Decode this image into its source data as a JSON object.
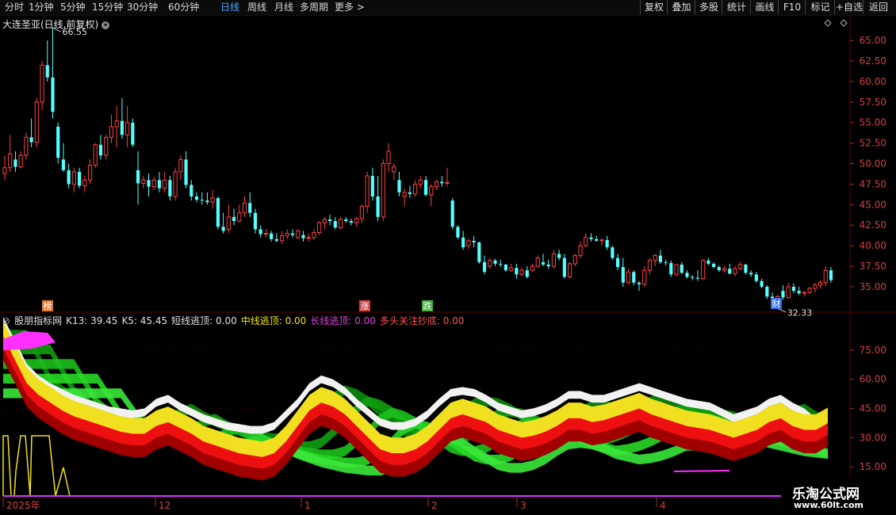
{
  "toolbar": {
    "periods": [
      {
        "label": "分时",
        "active": false
      },
      {
        "label": "1分钟",
        "active": false
      },
      {
        "label": "5分钟",
        "active": false
      },
      {
        "label": "15分钟",
        "active": false
      },
      {
        "label": "30分钟",
        "active": false
      },
      {
        "label": "60分钟",
        "active": false
      },
      {
        "label": "日线",
        "active": true
      },
      {
        "label": "周线",
        "active": false
      },
      {
        "label": "月线",
        "active": false
      },
      {
        "label": "多周期",
        "active": false
      },
      {
        "label": "更多 >",
        "active": false
      }
    ],
    "buttons": [
      "复权",
      "叠加",
      "多股",
      "统计",
      "画线",
      "F10",
      "标记",
      "+自选",
      "返回"
    ]
  },
  "main_chart": {
    "title": "大连圣亚(日线,前复权)",
    "title_icon": "chevron-down-icon",
    "high_label": "66.55",
    "low_label": "32.33",
    "markers": [
      {
        "text": "榜",
        "color": "#e07b2a"
      },
      {
        "text": "涨",
        "color": "#d04040"
      },
      {
        "text": "跌",
        "color": "#3fb040"
      },
      {
        "text": "财",
        "color": "#3a6fe0"
      }
    ]
  },
  "indicator": {
    "name": "股朋指标网",
    "values": [
      {
        "label": "K13: 39.45",
        "color": "#e0e0e0"
      },
      {
        "label": "K5: 45.45",
        "color": "#e0e0e0"
      },
      {
        "label": "短线逃顶: 0.00",
        "color": "#e0e0e0"
      },
      {
        "label": "中线逃顶: 0.00",
        "color": "#f0e020"
      },
      {
        "label": "长线逃顶: 0.00",
        "color": "#e040e0"
      },
      {
        "label": "多头关注抄底: 0.00",
        "color": "#ff5050"
      }
    ]
  },
  "logo": {
    "line1": "乐淘公式网",
    "line2": "www.60lt.com"
  },
  "colors": {
    "up": "#ff4040",
    "down": "#54ffff",
    "grid": "#5a0000"
  },
  "chart_data": [
    {
      "type": "candlestick",
      "title": "大连圣亚(日线,前复权)",
      "y_ticks": [
        "65.00",
        "62.50",
        "60.00",
        "57.50",
        "55.00",
        "52.50",
        "50.00",
        "47.50",
        "45.00",
        "42.50",
        "40.00",
        "37.50",
        "35.00"
      ],
      "ylim": [
        32.0,
        68.0
      ],
      "x_ticks": [
        "2025年",
        "12",
        "1",
        "2",
        "3",
        "4"
      ],
      "ohlc": [
        [
          48.8,
          51.0,
          48.0,
          49.5
        ],
        [
          49.5,
          53.5,
          49.0,
          51.2
        ],
        [
          50.5,
          51.5,
          49.0,
          49.6
        ],
        [
          49.6,
          51.5,
          49.4,
          51.0
        ],
        [
          51.0,
          53.8,
          50.5,
          53.2
        ],
        [
          53.2,
          55.5,
          52.0,
          52.6
        ],
        [
          52.6,
          58.0,
          52.0,
          57.5
        ],
        [
          57.5,
          62.5,
          56.5,
          62.0
        ],
        [
          62.0,
          65.0,
          60.0,
          60.5
        ],
        [
          60.5,
          66.55,
          55.5,
          56.3
        ],
        [
          54.5,
          55.0,
          50.0,
          50.7
        ],
        [
          50.5,
          52.5,
          49.0,
          49.2
        ],
        [
          49.2,
          50.0,
          47.0,
          47.5
        ],
        [
          47.5,
          49.5,
          46.5,
          49.0
        ],
        [
          49.0,
          49.5,
          47.0,
          47.3
        ],
        [
          47.3,
          48.5,
          46.5,
          48.0
        ],
        [
          48.0,
          50.5,
          47.5,
          49.8
        ],
        [
          49.8,
          52.5,
          49.5,
          52.3
        ],
        [
          52.3,
          53.5,
          50.5,
          51.0
        ],
        [
          51.0,
          53.5,
          50.5,
          53.2
        ],
        [
          53.2,
          56.0,
          52.5,
          54.5
        ],
        [
          54.5,
          57.0,
          52.0,
          55.2
        ],
        [
          55.2,
          58.0,
          53.0,
          53.5
        ],
        [
          53.5,
          57.0,
          52.0,
          55.0
        ],
        [
          55.0,
          55.5,
          52.0,
          52.3
        ],
        [
          49.2,
          51.5,
          45.0,
          47.6
        ],
        [
          47.6,
          48.5,
          47.0,
          48.0
        ],
        [
          48.0,
          48.8,
          46.0,
          47.2
        ],
        [
          47.2,
          48.4,
          46.8,
          48.0
        ],
        [
          48.0,
          49.0,
          46.5,
          47.0
        ],
        [
          47.0,
          49.0,
          46.5,
          48.0
        ],
        [
          48.0,
          48.5,
          45.5,
          46.0
        ],
        [
          46.0,
          49.5,
          45.5,
          49.0
        ],
        [
          49.0,
          51.0,
          48.0,
          50.5
        ],
        [
          50.5,
          51.5,
          47.0,
          47.4
        ],
        [
          47.4,
          48.0,
          45.5,
          46.0
        ],
        [
          46.0,
          46.5,
          45.3,
          45.6
        ],
        [
          45.6,
          46.5,
          45.0,
          45.5
        ],
        [
          45.5,
          46.5,
          45.0,
          45.3
        ],
        [
          45.3,
          46.8,
          44.5,
          45.8
        ],
        [
          45.8,
          46.0,
          42.0,
          42.3
        ],
        [
          42.3,
          44.0,
          41.5,
          41.8
        ],
        [
          42.0,
          45.0,
          41.5,
          43.5
        ],
        [
          43.5,
          44.5,
          42.5,
          43.0
        ],
        [
          43.0,
          45.0,
          42.8,
          44.0
        ],
        [
          44.0,
          46.0,
          43.5,
          45.2
        ],
        [
          45.2,
          46.5,
          43.5,
          44.0
        ],
        [
          44.0,
          44.5,
          41.5,
          42.0
        ],
        [
          42.0,
          42.5,
          41.0,
          41.4
        ],
        [
          41.4,
          42.0,
          41.0,
          41.5
        ],
        [
          41.5,
          41.8,
          40.5,
          40.8
        ],
        [
          40.8,
          41.5,
          40.4,
          40.6
        ],
        [
          40.6,
          41.8,
          40.2,
          41.2
        ],
        [
          41.2,
          42.0,
          40.8,
          41.5
        ],
        [
          41.5,
          42.0,
          41.0,
          41.3
        ],
        [
          41.0,
          42.0,
          40.8,
          41.8
        ],
        [
          41.3,
          41.8,
          40.5,
          40.9
        ],
        [
          40.9,
          41.5,
          40.5,
          41.0
        ],
        [
          41.0,
          42.0,
          40.7,
          41.6
        ],
        [
          41.6,
          43.0,
          41.3,
          42.8
        ],
        [
          42.8,
          43.5,
          42.0,
          43.2
        ],
        [
          43.2,
          43.8,
          42.5,
          43.0
        ],
        [
          43.0,
          43.5,
          42.0,
          42.2
        ],
        [
          42.2,
          43.5,
          42.0,
          43.2
        ],
        [
          43.2,
          43.5,
          42.8,
          43.0
        ],
        [
          43.0,
          43.3,
          42.5,
          42.8
        ],
        [
          42.8,
          43.5,
          42.3,
          43.3
        ],
        [
          43.3,
          45.0,
          42.8,
          44.8
        ],
        [
          44.8,
          49.0,
          44.0,
          48.5
        ],
        [
          48.5,
          49.5,
          45.5,
          46.0
        ],
        [
          46.0,
          48.5,
          43.0,
          43.5
        ],
        [
          43.5,
          50.5,
          43.0,
          50.0
        ],
        [
          50.0,
          52.5,
          49.0,
          51.5
        ],
        [
          49.0,
          50.0,
          48.0,
          49.6
        ],
        [
          48.0,
          49.0,
          46.0,
          46.5
        ],
        [
          46.0,
          47.0,
          44.8,
          46.5
        ],
        [
          46.5,
          47.3,
          45.8,
          46.3
        ],
        [
          46.3,
          48.0,
          46.0,
          47.5
        ],
        [
          47.5,
          48.5,
          47.0,
          48.0
        ],
        [
          48.0,
          48.5,
          46.0,
          46.2
        ],
        [
          46.2,
          47.5,
          44.8,
          47.2
        ],
        [
          47.2,
          48.0,
          46.8,
          47.8
        ],
        [
          47.8,
          48.5,
          47.2,
          47.6
        ],
        [
          47.6,
          49.5,
          47.2,
          47.7
        ],
        [
          45.5,
          45.8,
          42.0,
          42.3
        ],
        [
          42.3,
          42.5,
          40.8,
          41.0
        ],
        [
          41.0,
          41.8,
          39.5,
          39.8
        ],
        [
          40.0,
          40.8,
          39.6,
          40.6
        ],
        [
          40.6,
          41.2,
          39.8,
          40.4
        ],
        [
          40.4,
          40.5,
          37.8,
          38.0
        ],
        [
          38.0,
          38.8,
          36.5,
          36.8
        ],
        [
          37.5,
          38.5,
          37.2,
          38.2
        ],
        [
          38.2,
          38.4,
          37.5,
          37.8
        ],
        [
          37.8,
          38.3,
          37.4,
          37.7
        ],
        [
          37.7,
          37.8,
          36.8,
          37.0
        ],
        [
          37.0,
          37.8,
          36.8,
          37.3
        ],
        [
          37.3,
          37.8,
          36.0,
          36.5
        ],
        [
          36.5,
          37.3,
          36.3,
          37.0
        ],
        [
          37.0,
          37.5,
          36.0,
          36.2
        ],
        [
          37.0,
          37.8,
          36.8,
          37.5
        ],
        [
          37.5,
          38.8,
          37.3,
          38.5
        ],
        [
          38.0,
          39.0,
          37.5,
          37.7
        ],
        [
          37.7,
          38.3,
          37.2,
          37.5
        ],
        [
          37.5,
          39.5,
          37.2,
          39.0
        ],
        [
          39.0,
          39.5,
          38.2,
          38.5
        ],
        [
          38.5,
          39.0,
          36.0,
          36.2
        ],
        [
          36.2,
          38.0,
          36.0,
          37.8
        ],
        [
          37.8,
          39.0,
          37.5,
          38.8
        ],
        [
          38.8,
          40.5,
          38.5,
          40.0
        ],
        [
          40.0,
          41.5,
          39.8,
          41.0
        ],
        [
          41.0,
          41.5,
          40.5,
          40.8
        ],
        [
          40.8,
          41.2,
          40.5,
          40.6
        ],
        [
          40.6,
          40.9,
          40.0,
          40.7
        ],
        [
          40.7,
          41.2,
          39.5,
          39.8
        ],
        [
          39.8,
          40.0,
          38.3,
          38.5
        ],
        [
          38.5,
          39.0,
          37.0,
          37.4
        ],
        [
          37.4,
          38.5,
          35.0,
          35.5
        ],
        [
          35.5,
          37.2,
          35.3,
          36.8
        ],
        [
          36.8,
          37.0,
          35.2,
          35.5
        ],
        [
          35.5,
          35.7,
          34.5,
          35.3
        ],
        [
          35.3,
          37.5,
          35.0,
          37.0
        ],
        [
          37.0,
          38.5,
          36.5,
          38.2
        ],
        [
          38.2,
          39.0,
          37.5,
          38.8
        ],
        [
          38.8,
          39.5,
          37.8,
          38.0
        ],
        [
          38.0,
          38.3,
          37.6,
          37.9
        ],
        [
          37.9,
          38.2,
          36.2,
          36.5
        ],
        [
          36.5,
          37.8,
          36.3,
          37.7
        ],
        [
          37.7,
          38.0,
          36.5,
          36.7
        ],
        [
          36.7,
          37.0,
          36.0,
          36.2
        ],
        [
          36.2,
          36.4,
          35.8,
          36.1
        ],
        [
          36.1,
          37.0,
          35.7,
          36.0
        ],
        [
          36.0,
          38.4,
          35.8,
          38.2
        ],
        [
          38.2,
          38.5,
          37.6,
          37.8
        ],
        [
          37.8,
          38.0,
          37.3,
          37.4
        ],
        [
          37.4,
          37.6,
          36.8,
          37.0
        ],
        [
          37.0,
          37.5,
          36.7,
          37.2
        ],
        [
          37.2,
          37.8,
          36.5,
          36.6
        ],
        [
          36.6,
          37.5,
          36.3,
          37.2
        ],
        [
          37.2,
          38.0,
          37.0,
          37.7
        ],
        [
          37.7,
          37.8,
          36.5,
          36.7
        ],
        [
          36.7,
          37.0,
          36.2,
          36.5
        ],
        [
          36.5,
          36.8,
          35.5,
          35.7
        ],
        [
          35.7,
          36.0,
          34.8,
          35.0
        ],
        [
          35.0,
          35.2,
          33.5,
          33.8
        ],
        [
          33.8,
          34.3,
          32.8,
          33.2
        ],
        [
          33.2,
          34.0,
          32.33,
          33.8
        ],
        [
          34.5,
          35.2,
          33.4,
          33.7
        ],
        [
          33.7,
          35.5,
          33.5,
          35.0
        ],
        [
          35.0,
          35.4,
          34.2,
          34.5
        ],
        [
          34.5,
          35.0,
          34.0,
          34.2
        ],
        [
          34.2,
          34.5,
          33.8,
          34.3
        ],
        [
          34.3,
          35.0,
          34.1,
          34.8
        ],
        [
          34.8,
          35.5,
          34.3,
          35.2
        ],
        [
          35.2,
          35.8,
          34.8,
          35.5
        ],
        [
          35.5,
          37.5,
          35.0,
          37.0
        ],
        [
          37.0,
          37.4,
          35.5,
          35.8
        ]
      ]
    },
    {
      "type": "area",
      "title": "股朋指标网",
      "y_ticks": [
        "75.00",
        "60.00",
        "45.00",
        "30.00",
        "15.00"
      ],
      "ylim": [
        0,
        88
      ],
      "series": [
        {
          "name": "K13",
          "color": "#ffffff",
          "values": [
            92,
            80,
            68,
            62,
            58,
            55,
            52,
            50,
            48,
            46,
            45,
            44,
            45,
            50,
            52,
            48,
            45,
            42,
            40,
            38,
            37,
            36,
            36,
            38,
            44,
            50,
            58,
            62,
            60,
            56,
            50,
            45,
            40,
            38,
            38,
            40,
            44,
            50,
            55,
            56,
            55,
            52,
            48,
            46,
            44,
            45,
            47,
            50,
            54,
            54,
            52,
            52,
            54,
            56,
            58,
            56,
            54,
            52,
            50,
            49,
            48,
            45,
            42,
            44,
            46,
            50,
            52,
            48,
            45,
            40,
            39.45
          ]
        },
        {
          "name": "K5",
          "color": "#f0e020",
          "values": [
            90,
            78,
            66,
            60,
            56,
            52,
            49,
            47,
            45,
            43,
            41,
            40,
            40,
            44,
            46,
            43,
            40,
            36,
            34,
            32,
            30,
            29,
            28,
            30,
            36,
            44,
            52,
            56,
            54,
            50,
            44,
            38,
            32,
            30,
            30,
            32,
            36,
            42,
            48,
            50,
            48,
            46,
            42,
            40,
            38,
            39,
            41,
            44,
            48,
            48,
            46,
            47,
            49,
            51,
            53,
            50,
            48,
            46,
            44,
            43,
            42,
            40,
            38,
            40,
            42,
            46,
            48,
            44,
            42,
            42,
            45.45
          ]
        }
      ]
    }
  ]
}
